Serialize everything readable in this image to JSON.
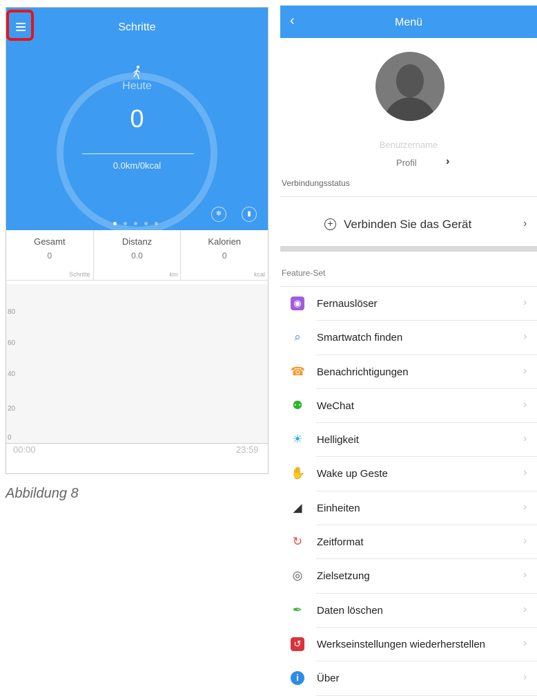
{
  "left_screen": {
    "title": "Schritte",
    "today_label": "Heute",
    "today_value": "0",
    "today_sub": "0.0km/0kcal",
    "stats": [
      {
        "label": "Gesamt",
        "value": "0",
        "unit": "Schritte"
      },
      {
        "label": "Distanz",
        "value": "0.0",
        "unit": "km"
      },
      {
        "label": "Kalorien",
        "value": "0",
        "unit": "kcal"
      }
    ],
    "chart": {
      "y_ticks": [
        "80",
        "60",
        "40",
        "20",
        "0"
      ],
      "x_start": "00:00",
      "x_end": "23:59"
    },
    "page_dots": 5,
    "active_dot": 0
  },
  "caption": "Abbildung 8",
  "right_screen": {
    "back_icon": "chevron-left-icon",
    "title": "Menü",
    "username": "Benutzername",
    "profile_label": "Profil",
    "connection_status_label": "Verbindungsstatus",
    "connect_label": "Verbinden Sie das Gerät",
    "feature_set_label": "Feature-Set",
    "features": [
      {
        "label": "Fernauslöser",
        "icon": "camera-icon",
        "color": "#a35dd8"
      },
      {
        "label": "Smartwatch finden",
        "icon": "search-watch-icon",
        "color": "#3b8fe6"
      },
      {
        "label": "Benachrichtigungen",
        "icon": "phone-notification-icon",
        "color": "#f39a2e"
      },
      {
        "label": "WeChat",
        "icon": "wechat-icon",
        "color": "#2cb52a"
      },
      {
        "label": "Helligkeit",
        "icon": "sun-icon",
        "color": "#2fa9ea"
      },
      {
        "label": "Wake up Geste",
        "icon": "wrist-gesture-icon",
        "color": "#2bb6c6"
      },
      {
        "label": "Einheiten",
        "icon": "ruler-icon",
        "color": "#333333"
      },
      {
        "label": "Zeitformat",
        "icon": "24h-clock-icon",
        "color": "#e84c3d"
      },
      {
        "label": "Zielsetzung",
        "icon": "target-icon",
        "color": "#555555"
      },
      {
        "label": "Daten löschen",
        "icon": "broom-icon",
        "color": "#3db84a"
      },
      {
        "label": "Werkseinstellungen wiederherstellen",
        "icon": "reset-icon",
        "color": "#d9343a"
      },
      {
        "label": "Über",
        "icon": "info-icon",
        "color": "#2d8de6"
      }
    ]
  },
  "colors": {
    "primary": "#3d9bf1",
    "highlight_border": "#e3161b"
  }
}
